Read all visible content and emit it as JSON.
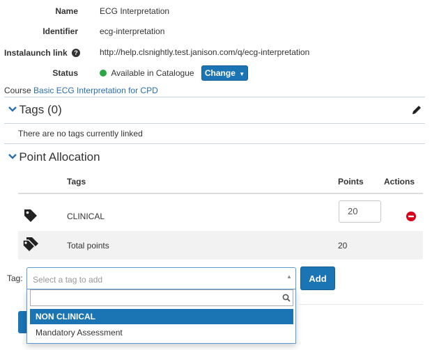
{
  "details": {
    "name_label": "Name",
    "name_value": "ECG Interpretation",
    "identifier_label": "Identifier",
    "identifier_value": "ecg-interpretation",
    "instalaunch_label": "Instalaunch link",
    "instalaunch_value": "http://help.clsnightly.test.janison.com/q/ecg-interpretation",
    "status_label": "Status",
    "status_value": "Available in Catalogue",
    "status_color": "#2aa745",
    "change_button": "Change",
    "course_label": "Course",
    "course_link": "Basic ECG Interpretation for CPD"
  },
  "tags_section": {
    "title": "Tags (0)",
    "empty_message": "There are no tags currently linked",
    "edit_icon": "pencil-icon"
  },
  "point_allocation": {
    "title": "Point Allocation",
    "columns": {
      "tags": "Tags",
      "points": "Points",
      "actions": "Actions"
    },
    "rows": [
      {
        "icon": "tag-icon",
        "tag": "CLINICAL",
        "points": "20",
        "action_icon": "remove-icon"
      }
    ],
    "total": {
      "icon": "tags-icon",
      "label": "Total points",
      "points": "20"
    }
  },
  "tag_picker": {
    "label": "Tag:",
    "placeholder": "Select a tag to add",
    "add_button": "Add",
    "search_value": "",
    "options": [
      "NON CLINICAL",
      "Mandatory Assessment"
    ],
    "highlighted": "NON CLINICAL"
  },
  "colors": {
    "accent": "#1b74b4",
    "link": "#2a6fb0",
    "remove": "#d9001b"
  }
}
